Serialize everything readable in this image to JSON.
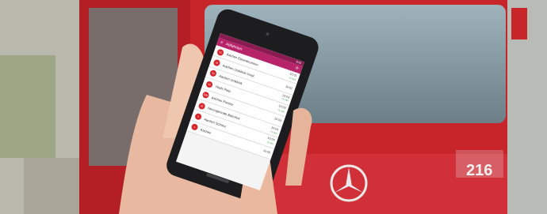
{
  "photo": {
    "bus_number": "216",
    "app": {
      "title": "Abfahrten",
      "status_time": "8:55",
      "departures": [
        {
          "line": "25",
          "stop": "Aachen Elisenbrunnen",
          "time": "10:01",
          "delay": "+1 min"
        },
        {
          "line": "33",
          "stop": "Aachen Uniklinik Vorpl.",
          "time": "10:02",
          "delay": ""
        },
        {
          "line": "3A",
          "stop": "Aachen Uniklinik",
          "time": "10:03",
          "delay": "+1 min"
        },
        {
          "line": "45",
          "stop": "Vaals Platz",
          "time": "10:03",
          "delay": "+1 min"
        },
        {
          "line": "SB6",
          "stop": "Aachen Ponttor",
          "time": "10:03",
          "delay": ""
        },
        {
          "line": "25",
          "stop": "Herzogenrath Bahnhof",
          "time": "10:04",
          "delay": "+1 min"
        },
        {
          "line": "5",
          "stop": "Aachen Schanz",
          "time": "10:04",
          "delay": "+1 min"
        },
        {
          "line": "1",
          "stop": "Aachen",
          "time": "10:05",
          "delay": ""
        }
      ]
    }
  }
}
